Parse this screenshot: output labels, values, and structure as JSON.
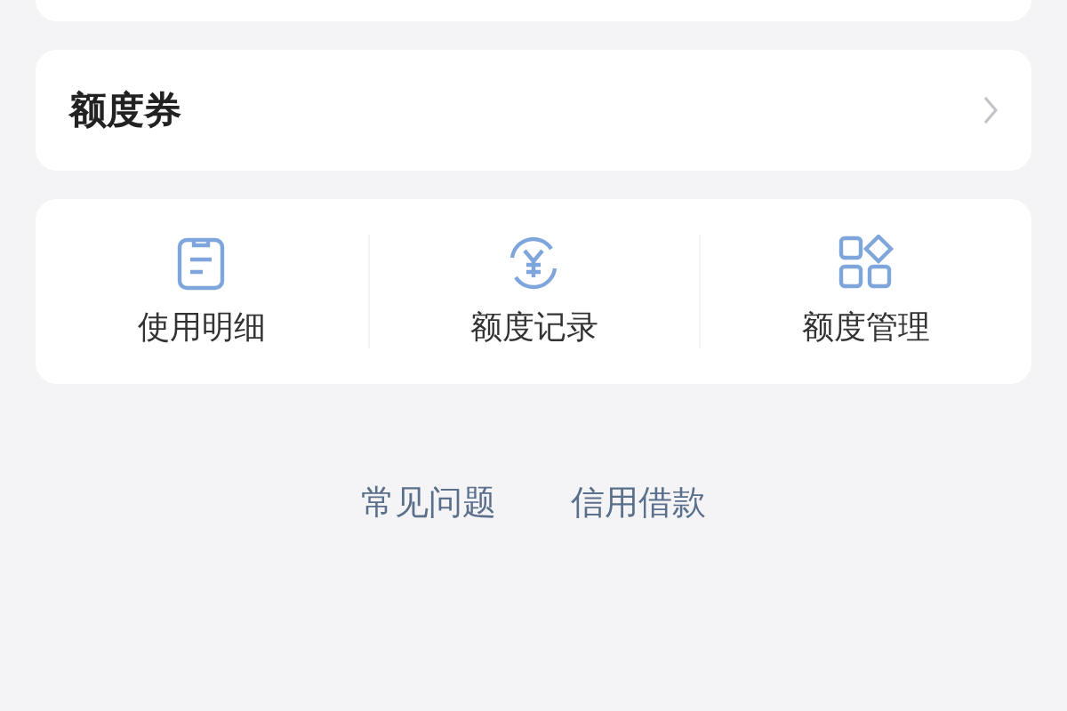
{
  "coupon_row": {
    "label": "额度券"
  },
  "shortcuts": [
    {
      "kind": "detail",
      "label": "使用明细"
    },
    {
      "kind": "record",
      "label": "额度记录"
    },
    {
      "kind": "manage",
      "label": "额度管理"
    }
  ],
  "footer_links": [
    "常见问题",
    "信用借款"
  ]
}
